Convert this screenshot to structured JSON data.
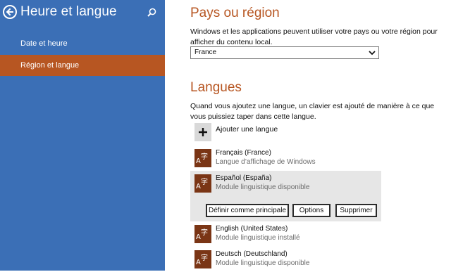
{
  "sidebar": {
    "title": "Heure et langue",
    "back_icon": "back-arrow-icon",
    "search_icon": "search-icon",
    "items": [
      {
        "label": "Date et heure",
        "selected": false
      },
      {
        "label": "Région et langue",
        "selected": true
      }
    ]
  },
  "region": {
    "heading": "Pays ou région",
    "description": "Windows et les applications peuvent utiliser votre pays ou votre région pour afficher du contenu local.",
    "selected_country": "France"
  },
  "languages": {
    "heading": "Langues",
    "description": "Quand vous ajoutez une langue, un clavier est ajouté de manière à ce que vous puissiez taper dans cette langue.",
    "add_label": "Ajouter une langue",
    "list": [
      {
        "name": "Français (France)",
        "status": "Langue d’affichage de Windows"
      },
      {
        "name": "Español (España)",
        "status": "Module linguistique disponible"
      },
      {
        "name": "English (United States)",
        "status": "Module linguistique installé"
      },
      {
        "name": "Deutsch (Deutschland)",
        "status": "Module linguistique disponible"
      }
    ],
    "actions": {
      "set_primary": "Définir comme principale",
      "options": "Options",
      "remove": "Supprimer"
    }
  },
  "colors": {
    "sidebar_bg": "#3b6fb6",
    "selected_bg": "#b75622",
    "accent_text": "#b75622",
    "lang_icon_bg": "#7a3515"
  }
}
